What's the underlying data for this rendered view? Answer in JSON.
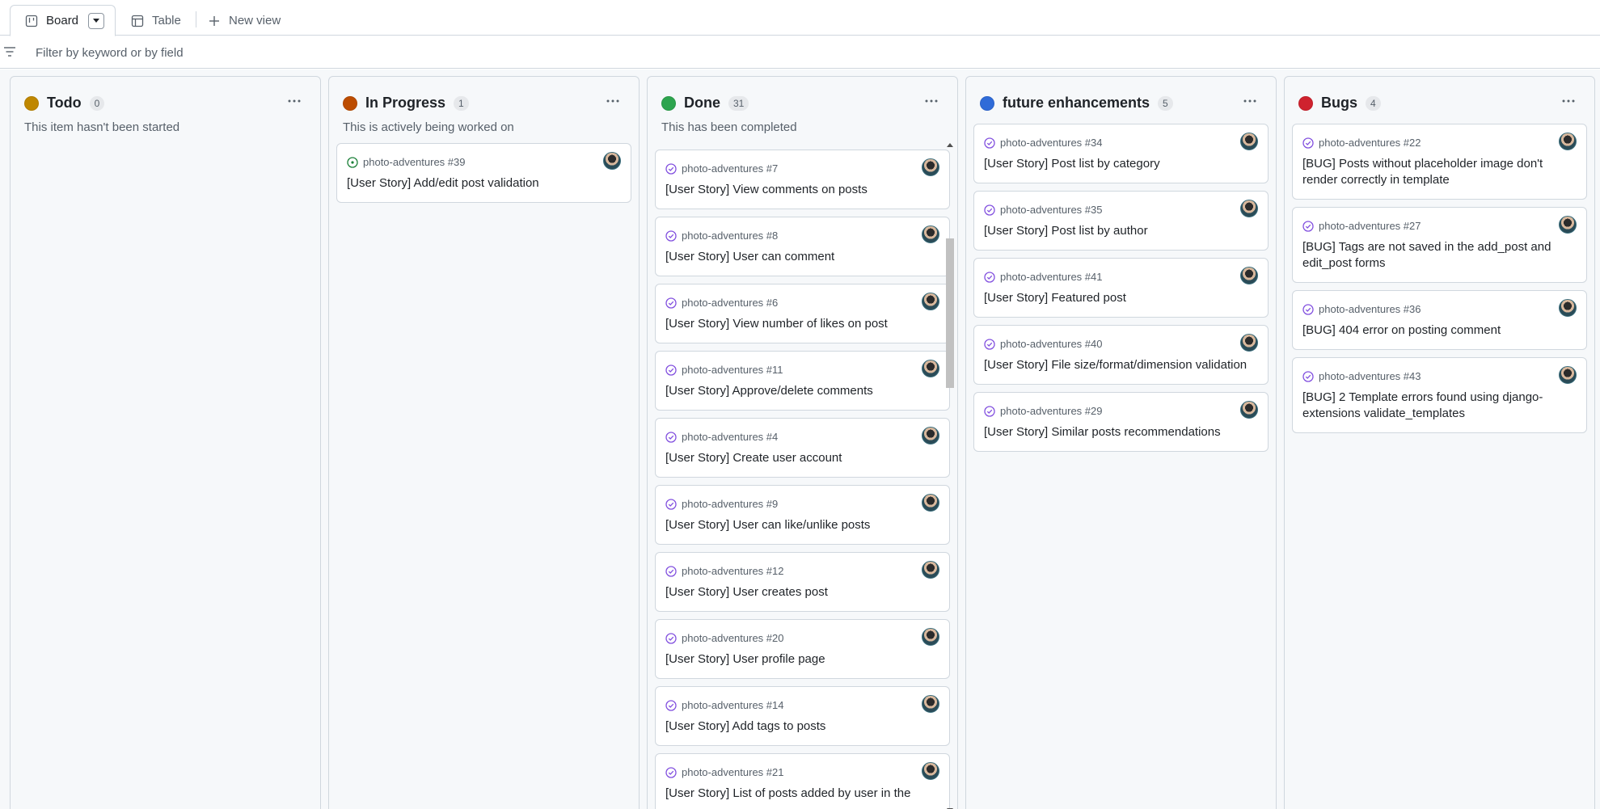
{
  "tabs": {
    "board": "Board",
    "table": "Table",
    "new_view": "New view"
  },
  "filter": {
    "placeholder": "Filter by keyword or by field"
  },
  "columns": [
    {
      "title": "Todo",
      "count": "0",
      "color": "#bf8700",
      "description": "This item hasn't been started",
      "cards": []
    },
    {
      "title": "In Progress",
      "count": "1",
      "color": "#bc4c00",
      "description": "This is actively being worked on",
      "cards": [
        {
          "ref": "photo-adventures #39",
          "title": "[User Story] Add/edit post validation",
          "status": "open"
        }
      ]
    },
    {
      "title": "Done",
      "count": "31",
      "color": "#2da44e",
      "description": "This has been completed",
      "cards": [
        {
          "ref": "photo-adventures #7",
          "title": "[User Story] View comments on posts",
          "status": "closed"
        },
        {
          "ref": "photo-adventures #8",
          "title": "[User Story] User can comment",
          "status": "closed"
        },
        {
          "ref": "photo-adventures #6",
          "title": "[User Story] View number of likes on post",
          "status": "closed"
        },
        {
          "ref": "photo-adventures #11",
          "title": "[User Story] Approve/delete comments",
          "status": "closed"
        },
        {
          "ref": "photo-adventures #4",
          "title": "[User Story] Create user account",
          "status": "closed"
        },
        {
          "ref": "photo-adventures #9",
          "title": "[User Story] User can like/unlike posts",
          "status": "closed"
        },
        {
          "ref": "photo-adventures #12",
          "title": "[User Story] User creates post",
          "status": "closed"
        },
        {
          "ref": "photo-adventures #20",
          "title": "[User Story] User profile page",
          "status": "closed"
        },
        {
          "ref": "photo-adventures #14",
          "title": "[User Story] Add tags to posts",
          "status": "closed"
        },
        {
          "ref": "photo-adventures #21",
          "title": "[User Story] List of posts added by user in the",
          "status": "closed"
        }
      ]
    },
    {
      "title": "future enhancements",
      "count": "5",
      "color": "#2f6bd8",
      "description": "",
      "cards": [
        {
          "ref": "photo-adventures #34",
          "title": "[User Story] Post list by category",
          "status": "closed"
        },
        {
          "ref": "photo-adventures #35",
          "title": "[User Story] Post list by author",
          "status": "closed"
        },
        {
          "ref": "photo-adventures #41",
          "title": "[User Story] Featured post",
          "status": "closed"
        },
        {
          "ref": "photo-adventures #40",
          "title": "[User Story] File size/format/dimension validation",
          "status": "closed"
        },
        {
          "ref": "photo-adventures #29",
          "title": "[User Story] Similar posts recommendations",
          "status": "closed"
        }
      ]
    },
    {
      "title": "Bugs",
      "count": "4",
      "color": "#cf222e",
      "description": "",
      "cards": [
        {
          "ref": "photo-adventures #22",
          "title": "[BUG] Posts without placeholder image don't render correctly in template",
          "status": "closed"
        },
        {
          "ref": "photo-adventures #27",
          "title": "[BUG] Tags are not saved in the add_post and edit_post forms",
          "status": "closed"
        },
        {
          "ref": "photo-adventures #36",
          "title": "[BUG] 404 error on posting comment",
          "status": "closed"
        },
        {
          "ref": "photo-adventures #43",
          "title": "[BUG] 2 Template errors found using django-extensions validate_templates",
          "status": "closed"
        }
      ]
    }
  ]
}
